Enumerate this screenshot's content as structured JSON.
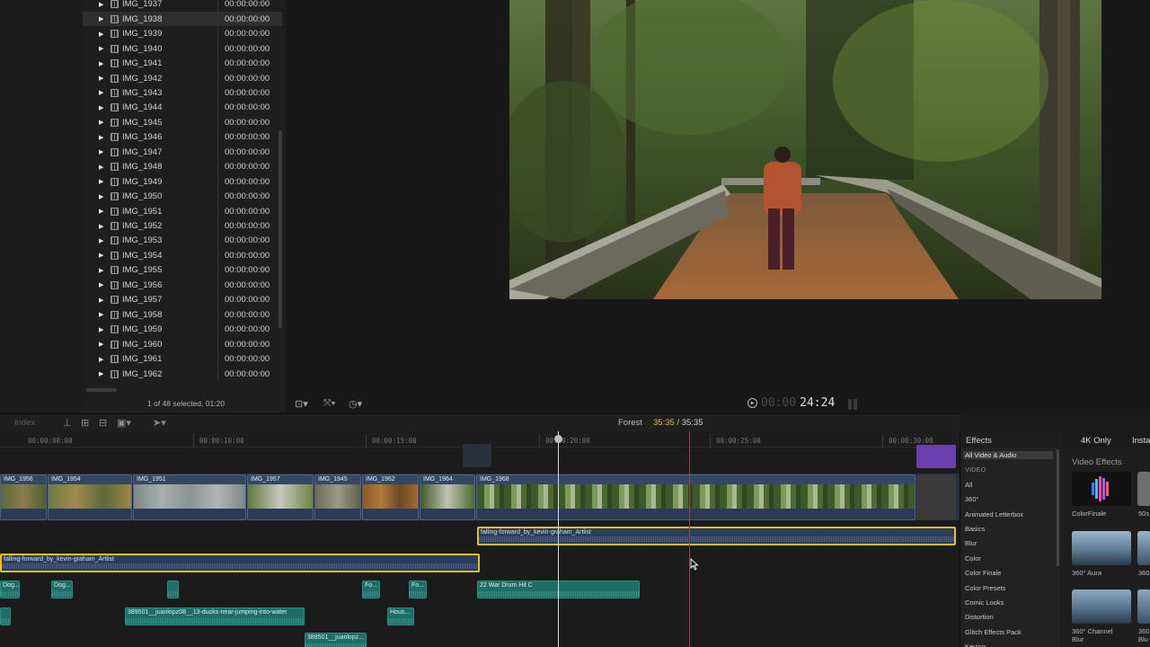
{
  "browser": {
    "clips": [
      {
        "name": "IMG_1937",
        "tc": "00:00:00:00"
      },
      {
        "name": "IMG_1938",
        "tc": "00:00:00:00"
      },
      {
        "name": "IMG_1939",
        "tc": "00:00:00:00"
      },
      {
        "name": "IMG_1940",
        "tc": "00:00:00:00"
      },
      {
        "name": "IMG_1941",
        "tc": "00:00:00:00"
      },
      {
        "name": "IMG_1942",
        "tc": "00:00:00:00"
      },
      {
        "name": "IMG_1943",
        "tc": "00:00:00:00"
      },
      {
        "name": "IMG_1944",
        "tc": "00:00:00:00"
      },
      {
        "name": "IMG_1945",
        "tc": "00:00:00:00"
      },
      {
        "name": "IMG_1946",
        "tc": "00:00:00:00"
      },
      {
        "name": "IMG_1947",
        "tc": "00:00:00:00"
      },
      {
        "name": "IMG_1948",
        "tc": "00:00:00:00"
      },
      {
        "name": "IMG_1949",
        "tc": "00:00:00:00"
      },
      {
        "name": "IMG_1950",
        "tc": "00:00:00:00"
      },
      {
        "name": "IMG_1951",
        "tc": "00:00:00:00"
      },
      {
        "name": "IMG_1952",
        "tc": "00:00:00:00"
      },
      {
        "name": "IMG_1953",
        "tc": "00:00:00:00"
      },
      {
        "name": "IMG_1954",
        "tc": "00:00:00:00"
      },
      {
        "name": "IMG_1955",
        "tc": "00:00:00:00"
      },
      {
        "name": "IMG_1956",
        "tc": "00:00:00:00"
      },
      {
        "name": "IMG_1957",
        "tc": "00:00:00:00"
      },
      {
        "name": "IMG_1958",
        "tc": "00:00:00:00"
      },
      {
        "name": "IMG_1959",
        "tc": "00:00:00:00"
      },
      {
        "name": "IMG_1960",
        "tc": "00:00:00:00"
      },
      {
        "name": "IMG_1961",
        "tc": "00:00:00:00"
      },
      {
        "name": "IMG_1962",
        "tc": "00:00:00:00"
      }
    ],
    "selected_index": 1,
    "status": "1 of 48 selected, 01:20"
  },
  "viewer": {
    "timecode_dim": "00:00",
    "timecode": "24:24"
  },
  "timeline": {
    "index_label": "Index",
    "project_name": "Forest",
    "duration_current": "35:35",
    "duration_total": " / 35:35",
    "ruler": [
      "00:00:00:00",
      "00:00:10:00",
      "00:00:15:00",
      "00:00:20:00",
      "00:00:25:00",
      "00:00:30:00"
    ],
    "primary_clips": [
      "IMG_1956",
      "IMG_1954",
      "IMG_1951",
      "IMG_1957",
      "IMG_1945",
      "IMG_1962",
      "IMG_1964",
      "IMG_1968"
    ],
    "music_clip_a": "falling-forward_by_kevin-graham_Artlist",
    "music_clip_b": "falling-forward_by_kevin-graham_Artlist",
    "sfx": {
      "dog1": "Dog...",
      "dog2": "Dog...",
      "fo1": "Fo...",
      "fo2": "Fo...",
      "drum": "22 War Drum Hit C",
      "ducks": "389501__juanlopz08__13-ducks-near-jumping-into-water",
      "hous": "Hous...",
      "juan2": "389501__juanlopz..."
    }
  },
  "effects": {
    "tab": "Effects",
    "filter_4k": "4K Only",
    "filter_insta": "Insta",
    "section_title": "Video Effects",
    "categories": [
      {
        "label": "All Video & Audio",
        "type": "selected"
      },
      {
        "label": "VIDEO",
        "type": "header"
      },
      {
        "label": "All",
        "type": "item"
      },
      {
        "label": "360°",
        "type": "item"
      },
      {
        "label": "Animated Letterbox",
        "type": "item"
      },
      {
        "label": "Basics",
        "type": "item"
      },
      {
        "label": "Blur",
        "type": "item"
      },
      {
        "label": "Color",
        "type": "item"
      },
      {
        "label": "Color Finale",
        "type": "item"
      },
      {
        "label": "Color Presets",
        "type": "item"
      },
      {
        "label": "Comic Looks",
        "type": "item"
      },
      {
        "label": "Distortion",
        "type": "item"
      },
      {
        "label": "Glitch Effects Pack",
        "type": "item"
      },
      {
        "label": "Keying",
        "type": "item"
      }
    ],
    "items": [
      {
        "label": "ColorFinale",
        "label2": ""
      },
      {
        "label": "50s",
        "label2": ""
      },
      {
        "label": "360° Aura",
        "label2": ""
      },
      {
        "label": "360",
        "label2": ""
      },
      {
        "label": "360° Channel",
        "label2": "Blur"
      },
      {
        "label": "360",
        "label2": "Blu"
      }
    ]
  }
}
